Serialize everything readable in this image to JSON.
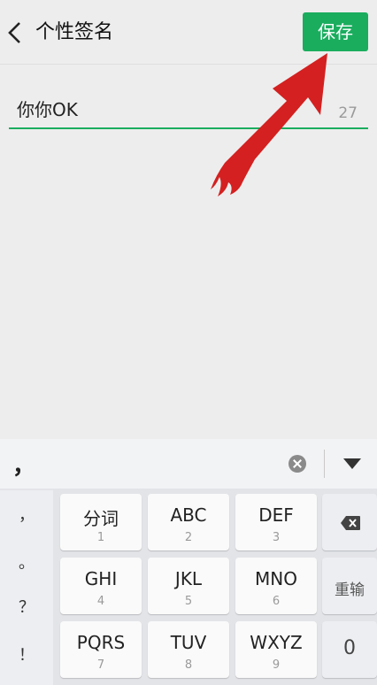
{
  "header": {
    "title": "个性签名",
    "save_label": "保存"
  },
  "input": {
    "value": "你你OK",
    "remaining_count": "27"
  },
  "keyboard": {
    "candidate": "，",
    "punctuation": [
      "，",
      "。",
      "？",
      "！"
    ],
    "keys": [
      {
        "main": "分词",
        "num": "1"
      },
      {
        "main": "ABC",
        "num": "2"
      },
      {
        "main": "DEF",
        "num": "3"
      },
      {
        "main": "GHI",
        "num": "4"
      },
      {
        "main": "JKL",
        "num": "5"
      },
      {
        "main": "MNO",
        "num": "6"
      },
      {
        "main": "PQRS",
        "num": "7"
      },
      {
        "main": "TUV",
        "num": "8"
      },
      {
        "main": "WXYZ",
        "num": "9"
      }
    ],
    "retype_label": "重输",
    "zero_label": "0"
  },
  "colors": {
    "accent": "#1aad5e",
    "annotation_arrow": "#d42020"
  }
}
